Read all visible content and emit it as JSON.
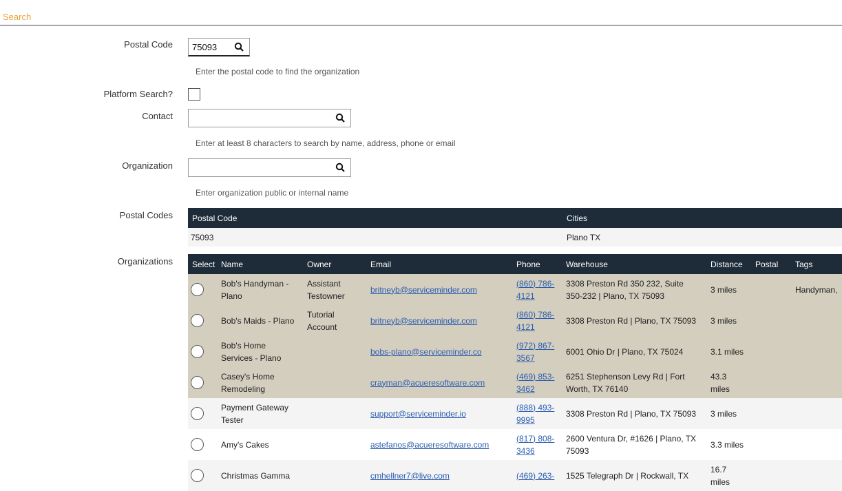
{
  "section": {
    "title": "Search"
  },
  "form": {
    "postal_code": {
      "label": "Postal Code",
      "value": "75093",
      "help": "Enter the postal code to find the organization"
    },
    "platform_search": {
      "label": "Platform Search?",
      "checked": false
    },
    "contact": {
      "label": "Contact",
      "value": "",
      "help": "Enter at least 8 characters to search by name, address, phone or email"
    },
    "organization": {
      "label": "Organization",
      "value": "",
      "help": "Enter organization public or internal name"
    }
  },
  "postal_codes": {
    "label": "Postal Codes",
    "columns": [
      "Postal Code",
      "Cities"
    ],
    "rows": [
      {
        "postal_code": "75093",
        "cities": "Plano TX"
      }
    ]
  },
  "organizations": {
    "label": "Organizations",
    "columns": [
      "Select",
      "Name",
      "Owner",
      "Email",
      "Phone",
      "Warehouse",
      "Distance",
      "Postal",
      "Tags"
    ],
    "rows": [
      {
        "name": "Bob's Handyman - Plano",
        "owner": "Assistant Testowner",
        "email": "britneyb@serviceminder.com",
        "phone": "(860) 786-4121",
        "warehouse": "3308 Preston Rd 350 232, Suite 350-232 | Plano, TX 75093",
        "distance": "3 miles",
        "postal": "",
        "tags": "Handyman,",
        "style": "hl"
      },
      {
        "name": "Bob's Maids - Plano",
        "owner": "Tutorial Account",
        "email": "britneyb@serviceminder.com",
        "phone": "(860) 786-4121",
        "warehouse": "3308 Preston Rd | Plano, TX 75093",
        "distance": "3 miles",
        "postal": "",
        "tags": "",
        "style": "hl"
      },
      {
        "name": "Bob's Home Services - Plano",
        "owner": "",
        "email": "bobs-plano@serviceminder.co",
        "phone": "(972) 867-3567",
        "warehouse": "6001 Ohio Dr | Plano, TX 75024",
        "distance": "3.1 miles",
        "postal": "",
        "tags": "",
        "style": "hl"
      },
      {
        "name": "Casey's Home Remodeling",
        "owner": "",
        "email": "crayman@acueresoftware.com",
        "phone": "(469) 853-3462",
        "warehouse": "6251 Stephenson Levy Rd | Fort Worth, TX 76140",
        "distance": "43.3 miles",
        "postal": "",
        "tags": "",
        "style": "hl"
      },
      {
        "name": "Payment Gateway Tester",
        "owner": "",
        "email": "support@serviceminder.io",
        "phone": "(888) 493-9995",
        "warehouse": "3308 Preston Rd | Plano, TX 75093",
        "distance": "3 miles",
        "postal": "",
        "tags": "",
        "style": "alt"
      },
      {
        "name": "Amy's Cakes",
        "owner": "",
        "email": "astefanos@acueresoftware.com",
        "phone": "(817) 808-3436",
        "warehouse": "2600 Ventura Dr, #1626 | Plano, TX 75093",
        "distance": "3.3 miles",
        "postal": "",
        "tags": "",
        "style": "nrm"
      },
      {
        "name": "Christmas Gamma",
        "owner": "",
        "email": "cmhellner7@live.com",
        "phone": "(469) 263-",
        "warehouse": "1525 Telegraph Dr | Rockwall, TX",
        "distance": "16.7 miles",
        "postal": "",
        "tags": "",
        "style": "alt"
      }
    ]
  },
  "icons": {
    "search": "search-icon",
    "radio": "radio-button"
  }
}
